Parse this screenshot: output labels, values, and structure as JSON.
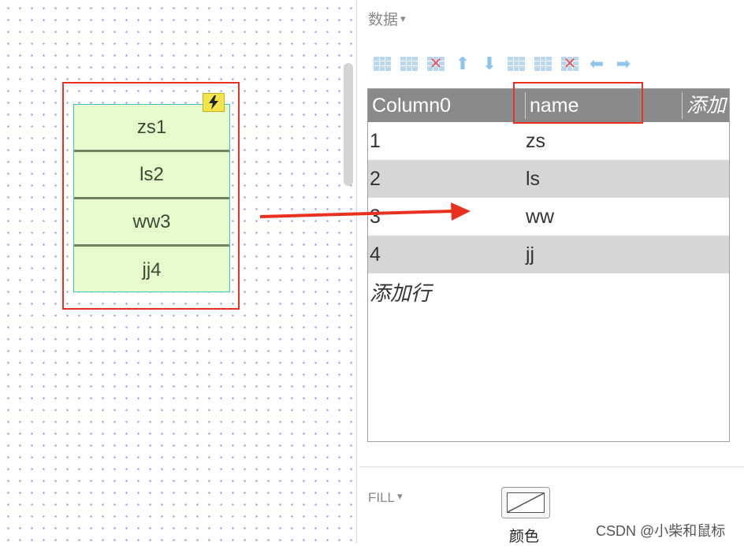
{
  "canvas": {
    "widget_rows": [
      "zs1",
      "ls2",
      "ww3",
      "jj4"
    ],
    "widget_badge_icon": "lightning-bolt-icon",
    "selection_color": "#e8321f"
  },
  "panel": {
    "data_section": {
      "label": "数据",
      "caret": "▾"
    },
    "toolbar": [
      {
        "name": "insert-column-left-icon"
      },
      {
        "name": "insert-column-right-icon"
      },
      {
        "name": "delete-column-icon"
      },
      {
        "name": "move-up-icon",
        "glyph": "⬆"
      },
      {
        "name": "move-down-icon",
        "glyph": "⬇"
      },
      {
        "name": "insert-row-above-icon"
      },
      {
        "name": "insert-row-below-icon"
      },
      {
        "name": "delete-row-icon"
      },
      {
        "name": "move-left-icon",
        "glyph": "⬅"
      },
      {
        "name": "move-right-icon",
        "glyph": "➡"
      }
    ],
    "table": {
      "headers": [
        "Column0",
        "name",
        "添加"
      ],
      "rows": [
        [
          "1",
          "zs"
        ],
        [
          "2",
          "ls"
        ],
        [
          "3",
          "ww"
        ],
        [
          "4",
          "jj"
        ]
      ],
      "add_row_label": "添加行"
    },
    "fill_section": {
      "label": "FILL",
      "caret": "▾"
    },
    "color_label": "颜色"
  },
  "watermark": "CSDN @小柴和鼠标"
}
